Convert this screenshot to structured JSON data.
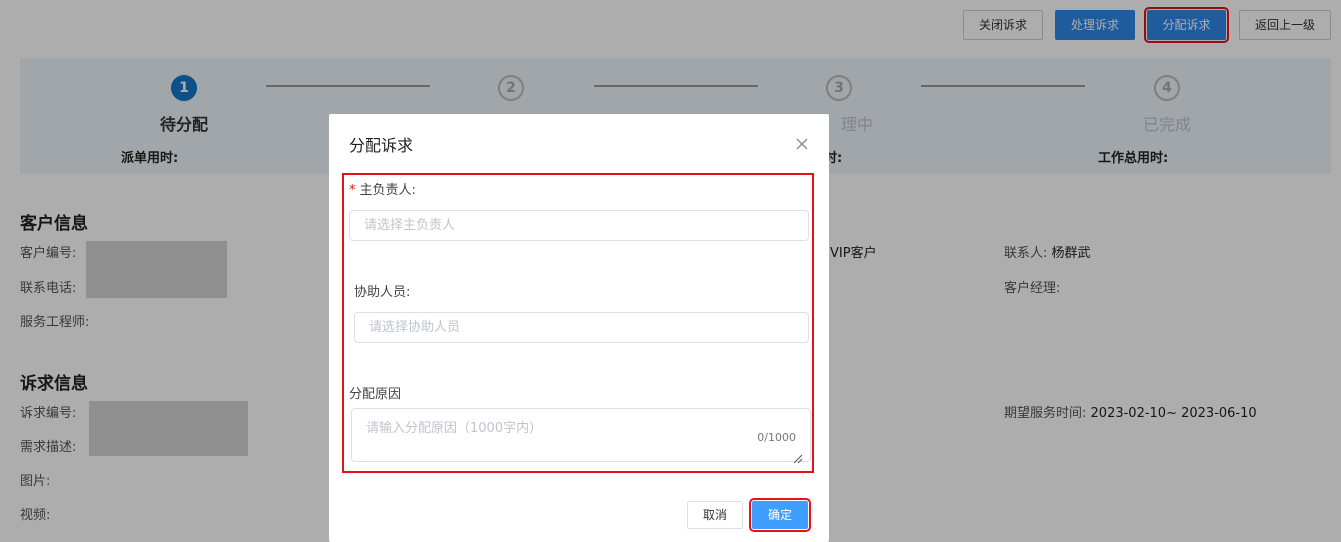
{
  "toolbar": {
    "close_label": "关闭诉求",
    "process_label": "处理诉求",
    "assign_label": "分配诉求",
    "back_label": "返回上一级"
  },
  "steps": [
    {
      "num": "1",
      "label": "待分配"
    },
    {
      "num": "2",
      "label": ""
    },
    {
      "num": "3",
      "label": "理中"
    },
    {
      "num": "4",
      "label": "已完成"
    }
  ],
  "step_times": {
    "dispatch": "派单用时:",
    "mid": "时:",
    "total": "工作总用时:"
  },
  "customer": {
    "title": "客户信息",
    "id_label": "客户编号:",
    "phone_label": "联系电话:",
    "engineer_label": "服务工程师:",
    "level_value": "VIP客户",
    "contact_label": "联系人:",
    "contact_value": "杨群武",
    "manager_label": "客户经理:"
  },
  "request": {
    "title": "诉求信息",
    "id_label": "诉求编号:",
    "desc_label": "需求描述:",
    "image_label": "图片:",
    "video_label": "视频:",
    "expected_label": "期望服务时间:",
    "expected_value": "2023-02-10~ 2023-06-10"
  },
  "dialog": {
    "title": "分配诉求",
    "required_mark": "*",
    "owner_label": "主负责人:",
    "owner_placeholder": "请选择主负责人",
    "assist_label": "协助人员:",
    "assist_placeholder": "请选择协助人员",
    "reason_label": "分配原因",
    "reason_placeholder": "请输入分配原因（1000字内）",
    "counter": "0/1000",
    "cancel_label": "取消",
    "ok_label": "确定"
  },
  "colors": {
    "primary": "#2f86e8",
    "highlight": "#e5121b",
    "step_active": "#1677c9"
  }
}
